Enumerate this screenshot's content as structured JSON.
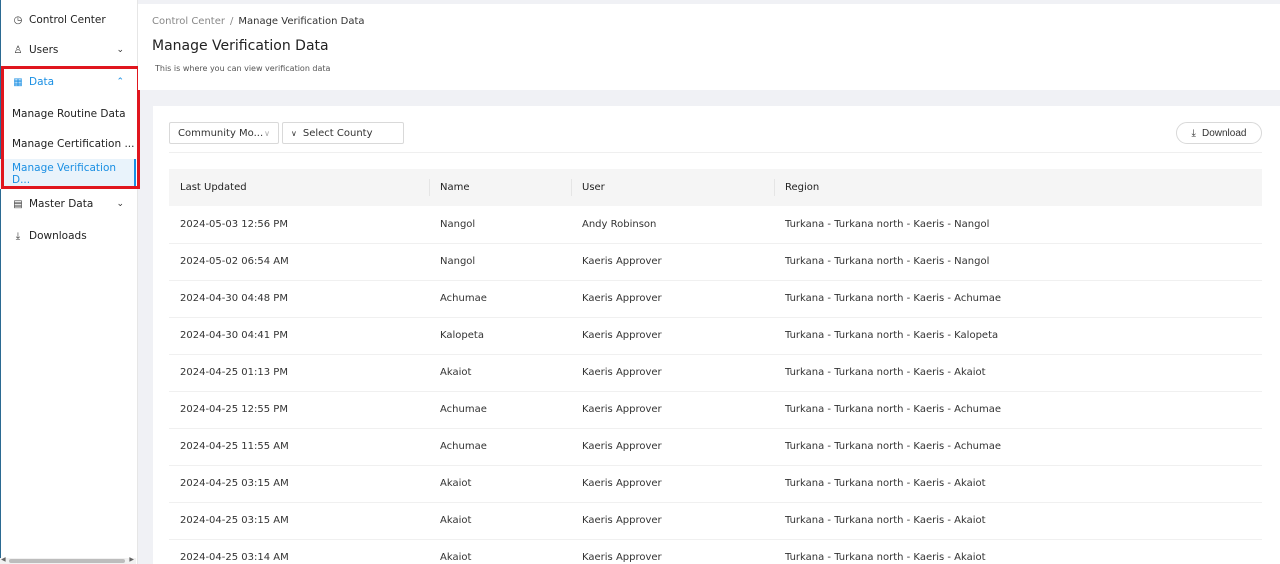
{
  "sidebar": {
    "items": [
      {
        "label": "Control Center",
        "icon": "dashboard-icon"
      },
      {
        "label": "Users",
        "icon": "user-icon"
      },
      {
        "label": "Data",
        "icon": "table-icon"
      },
      {
        "label": "Manage Routine Data"
      },
      {
        "label": "Manage Certification ..."
      },
      {
        "label": "Manage Verification D..."
      },
      {
        "label": "Master Data",
        "icon": "document-icon"
      },
      {
        "label": "Downloads",
        "icon": "download-icon"
      }
    ],
    "glyphs": {
      "dashboard": "◷",
      "user": "♙",
      "table": "▦",
      "document": "▤",
      "download": "⤓",
      "chev_down": "⌄",
      "chev_up": "⌃"
    }
  },
  "header": {
    "breadcrumb_root": "Control Center",
    "breadcrumb_sep": "/",
    "breadcrumb_current": "Manage Verification Data",
    "title": "Manage Verification Data",
    "subtitle": "This is where you can view verification data"
  },
  "filters": {
    "community_value": "Community Mo...",
    "county_placeholder": "Select County",
    "caret": "∨"
  },
  "toolbar": {
    "download_label": "Download",
    "download_icon": "⤓"
  },
  "table": {
    "columns": [
      "Last Updated",
      "Name",
      "User",
      "Region"
    ],
    "rows": [
      [
        "2024-05-03 12:56 PM",
        "Nangol",
        "Andy Robinson",
        "Turkana - Turkana north - Kaeris - Nangol"
      ],
      [
        "2024-05-02 06:54 AM",
        "Nangol",
        "Kaeris Approver",
        "Turkana - Turkana north - Kaeris - Nangol"
      ],
      [
        "2024-04-30 04:48 PM",
        "Achumae",
        "Kaeris Approver",
        "Turkana - Turkana north - Kaeris - Achumae"
      ],
      [
        "2024-04-30 04:41 PM",
        "Kalopeta",
        "Kaeris Approver",
        "Turkana - Turkana north - Kaeris - Kalopeta"
      ],
      [
        "2024-04-25 01:13 PM",
        "Akaiot",
        "Kaeris Approver",
        "Turkana - Turkana north - Kaeris - Akaiot"
      ],
      [
        "2024-04-25 12:55 PM",
        "Achumae",
        "Kaeris Approver",
        "Turkana - Turkana north - Kaeris - Achumae"
      ],
      [
        "2024-04-25 11:55 AM",
        "Achumae",
        "Kaeris Approver",
        "Turkana - Turkana north - Kaeris - Achumae"
      ],
      [
        "2024-04-25 03:15 AM",
        "Akaiot",
        "Kaeris Approver",
        "Turkana - Turkana north - Kaeris - Akaiot"
      ],
      [
        "2024-04-25 03:15 AM",
        "Akaiot",
        "Kaeris Approver",
        "Turkana - Turkana north - Kaeris - Akaiot"
      ],
      [
        "2024-04-25 03:14 AM",
        "Akaiot",
        "Kaeris Approver",
        "Turkana - Turkana north - Kaeris - Akaiot"
      ]
    ]
  },
  "colors": {
    "accent": "#1a8fe3",
    "highlight": "#e0161e",
    "background": "#f0f1f5"
  }
}
